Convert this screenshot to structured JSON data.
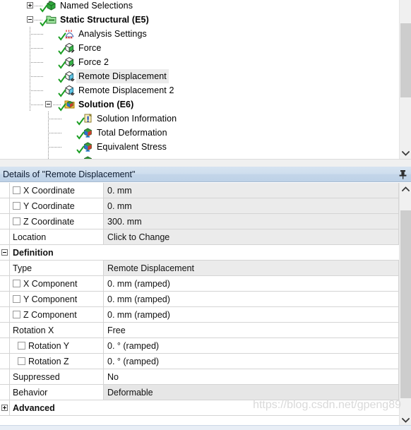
{
  "tree": {
    "items": [
      {
        "label": "Named Selections",
        "indent": 0,
        "bold": false,
        "selected": false,
        "expander": "plus",
        "icon": "named-selections-icon",
        "check": true
      },
      {
        "label": "Static Structural (E5)",
        "indent": 0,
        "bold": true,
        "selected": false,
        "expander": "minus",
        "icon": "static-structural-icon",
        "check": true
      },
      {
        "label": "Analysis Settings",
        "indent": 1,
        "bold": false,
        "selected": false,
        "expander": "none",
        "icon": "analysis-settings-icon",
        "check": true
      },
      {
        "label": "Force",
        "indent": 1,
        "bold": false,
        "selected": false,
        "expander": "none",
        "icon": "force-icon",
        "check": true
      },
      {
        "label": "Force 2",
        "indent": 1,
        "bold": false,
        "selected": false,
        "expander": "none",
        "icon": "force-icon",
        "check": true
      },
      {
        "label": "Remote Displacement",
        "indent": 1,
        "bold": false,
        "selected": true,
        "expander": "none",
        "icon": "remote-displacement-icon",
        "check": true
      },
      {
        "label": "Remote Displacement 2",
        "indent": 1,
        "bold": false,
        "selected": false,
        "expander": "none",
        "icon": "remote-displacement-icon",
        "check": true
      },
      {
        "label": "Solution (E6)",
        "indent": 1,
        "bold": true,
        "selected": false,
        "expander": "minus",
        "icon": "solution-icon",
        "check": true
      },
      {
        "label": "Solution Information",
        "indent": 2,
        "bold": false,
        "selected": false,
        "expander": "none",
        "icon": "solution-information-icon",
        "check": true
      },
      {
        "label": "Total Deformation",
        "indent": 2,
        "bold": false,
        "selected": false,
        "expander": "none",
        "icon": "result-icon",
        "check": true
      },
      {
        "label": "Equivalent Stress",
        "indent": 2,
        "bold": false,
        "selected": false,
        "expander": "none",
        "icon": "result-icon",
        "check": true
      }
    ],
    "scrollbar": {
      "down_arrow": "chevron-down-icon"
    }
  },
  "details": {
    "title": "Details of \"Remote Displacement\"",
    "pin_icon": "pin-icon",
    "scrollbar": {
      "up_arrow": "chevron-up-icon",
      "down_arrow": "chevron-down-icon"
    },
    "rows": [
      {
        "kind": "prop",
        "checkbox": true,
        "indent": 1,
        "name": "X Coordinate",
        "value": "0. mm",
        "value_style": "grey"
      },
      {
        "kind": "prop",
        "checkbox": true,
        "indent": 1,
        "name": "Y Coordinate",
        "value": "0. mm",
        "value_style": "grey"
      },
      {
        "kind": "prop",
        "checkbox": true,
        "indent": 1,
        "name": "Z Coordinate",
        "value": "300. mm",
        "value_style": "grey"
      },
      {
        "kind": "prop",
        "checkbox": false,
        "indent": 0,
        "name": "Location",
        "value": "Click to Change",
        "value_style": "grey"
      },
      {
        "kind": "section",
        "expander": "minus",
        "name": "Definition",
        "value": ""
      },
      {
        "kind": "prop",
        "checkbox": false,
        "indent": 0,
        "name": "Type",
        "value": "Remote Displacement",
        "value_style": "grey"
      },
      {
        "kind": "prop",
        "checkbox": true,
        "indent": 1,
        "name": "X Component",
        "value": "0. mm  (ramped)",
        "value_style": "white"
      },
      {
        "kind": "prop",
        "checkbox": true,
        "indent": 1,
        "name": "Y Component",
        "value": "0. mm  (ramped)",
        "value_style": "white"
      },
      {
        "kind": "prop",
        "checkbox": true,
        "indent": 1,
        "name": "Z Component",
        "value": "0. mm  (ramped)",
        "value_style": "white"
      },
      {
        "kind": "prop",
        "checkbox": false,
        "indent": 1,
        "name": "Rotation X",
        "value": "Free",
        "value_style": "white"
      },
      {
        "kind": "prop",
        "checkbox": true,
        "indent": 2,
        "name": "Rotation Y",
        "value": "0. °  (ramped)",
        "value_style": "white"
      },
      {
        "kind": "prop",
        "checkbox": true,
        "indent": 2,
        "name": "Rotation Z",
        "value": "0. °  (ramped)",
        "value_style": "white"
      },
      {
        "kind": "prop",
        "checkbox": false,
        "indent": 0,
        "name": "Suppressed",
        "value": "No",
        "value_style": "white"
      },
      {
        "kind": "prop",
        "checkbox": false,
        "indent": 0,
        "name": "Behavior",
        "value": "Deformable",
        "value_style": "selected"
      },
      {
        "kind": "section",
        "expander": "plus",
        "name": "Advanced",
        "value": ""
      }
    ]
  },
  "watermark": {
    "text": "https://blog.csdn.net/gpeng89"
  },
  "colors": {
    "header_gradient_start": "#d6e3f0",
    "header_gradient_end": "#bed2e7",
    "value_cell": "#ebebeb",
    "selected_row": "#ececec",
    "grid_line": "#d4d4d4",
    "scroll_thumb": "#cdcdcd",
    "check_green": "#1a9e22"
  }
}
